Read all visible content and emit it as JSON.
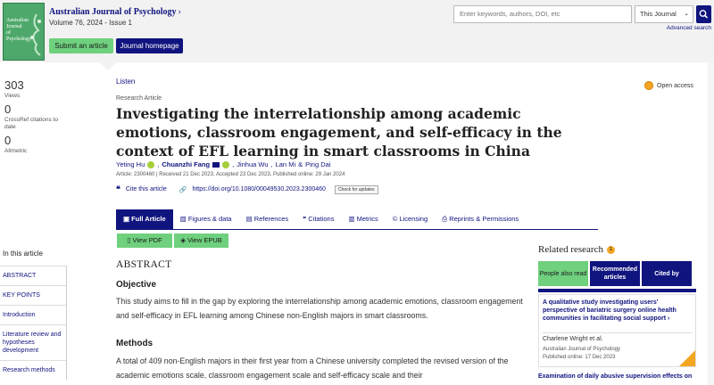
{
  "header": {
    "cover_text": "Australian Journal of Psychology",
    "journal_title": "Australian Journal of Psychology",
    "volume": "Volume 76, 2024 - Issue 1",
    "submit_label": "Submit an article",
    "homepage_label": "Journal homepage",
    "search_placeholder": "Enter keywords, authors, DOI, etc",
    "search_scope": "This Journal",
    "advanced_search": "Advanced search"
  },
  "metrics": [
    {
      "value": "303",
      "label": "Views"
    },
    {
      "value": "0",
      "label": "CrossRef citations to date"
    },
    {
      "value": "0",
      "label": "Altmetric"
    }
  ],
  "article": {
    "listen": "Listen",
    "open_access": "Open access",
    "type": "Research Article",
    "title": "Investigating the interrelationship among academic emotions, classroom engagement, and self-efficacy in the context of EFL learning in smart classrooms in China",
    "authors": [
      "Yeting Hu",
      "Chuanzhi Fang",
      "Jinhua Wu",
      "Lan Mi",
      "Ping Dai"
    ],
    "meta": "Article: 2300460 | Received 21 Dec 2023, Accepted 23 Dec 2023, Published online: 29 Jan 2024",
    "cite_label": "Cite this article",
    "doi": "https://doi.org/10.1080/00049530.2023.2300460",
    "check_updates": "Check for updates"
  },
  "tabs": [
    {
      "label": "Full Article",
      "active": true
    },
    {
      "label": "Figures & data"
    },
    {
      "label": "References"
    },
    {
      "label": "Citations"
    },
    {
      "label": "Metrics"
    },
    {
      "label": "Licensing"
    },
    {
      "label": "Reprints & Permissions"
    }
  ],
  "downloads": {
    "pdf": "View PDF",
    "epub": "View EPUB"
  },
  "nav": {
    "title": "In this article",
    "items": [
      "ABSTRACT",
      "KEY POINTS",
      "Introduction",
      "Literature review and hypotheses development",
      "Research methods"
    ]
  },
  "body": {
    "abstract_heading": "ABSTRACT",
    "objective_heading": "Objective",
    "objective_text": "This study aims to fill in the gap by exploring the interrelationship among academic emotions, classroom engagement and self-efficacy in EFL learning among Chinese non-English majors in smart classrooms.",
    "methods_heading": "Methods",
    "methods_text": "A total of 409 non-English majors in their first year from a Chinese university completed the revised version of the academic emotions scale, classroom engagement scale and self-efficacy scale and their"
  },
  "related": {
    "heading": "Related research",
    "badge": "1",
    "tabs": [
      {
        "label": "People also read",
        "active": true
      },
      {
        "label": "Recommended articles"
      },
      {
        "label": "Cited by"
      }
    ],
    "card": {
      "title": "A qualitative study investigating users' perspective of bariatric surgery online health communities in facilitating social support",
      "author": "Charlene Wright et al.",
      "journal": "Australian Journal of Psychology",
      "date": "Published online: 17 Dec 2023"
    },
    "next_title": "Examination of daily abusive supervision effects on"
  },
  "colors": {
    "navy": "#10147e",
    "green": "#6fd07e",
    "orange": "#f4a623"
  }
}
